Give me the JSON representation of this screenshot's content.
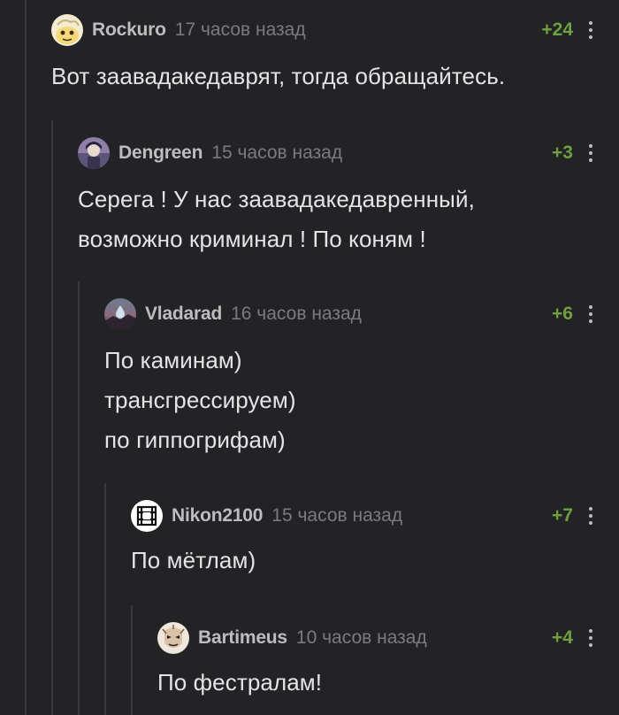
{
  "comments": [
    {
      "author": "Rockuro",
      "time": "17 часов назад",
      "rating": "+24",
      "avatar_icon": "cartoon-face-avatar",
      "lines": [
        "Вот заавадакедаврят, тогда обращайтесь."
      ]
    },
    {
      "author": "Dengreen",
      "time": "15 часов назад",
      "rating": "+3",
      "avatar_icon": "character-avatar",
      "lines": [
        "Серега ! У нас заавадакедавренный,",
        "возможно криминал ! По коням !"
      ]
    },
    {
      "author": "Vladarad",
      "time": "16 часов назад",
      "rating": "+6",
      "avatar_icon": "droplet-avatar",
      "lines": [
        "По каминам)",
        "трансгрессируем)",
        "по гиппогрифам)"
      ]
    },
    {
      "author": "Nikon2100",
      "time": "15 часов назад",
      "rating": "+7",
      "avatar_icon": "rammstein-logo-avatar",
      "lines": [
        "По мётлам)"
      ]
    },
    {
      "author": "Bartimeus",
      "time": "10 часов назад",
      "rating": "+4",
      "avatar_icon": "mask-face-avatar",
      "lines": [
        "По фестралам!"
      ]
    }
  ],
  "colors": {
    "background": "#232325",
    "rating_positive": "#6ea041",
    "author": "#bdbdbf",
    "time": "#7b7b7e",
    "text": "#e4e4e6",
    "thread_line": "#3a3a3d"
  }
}
